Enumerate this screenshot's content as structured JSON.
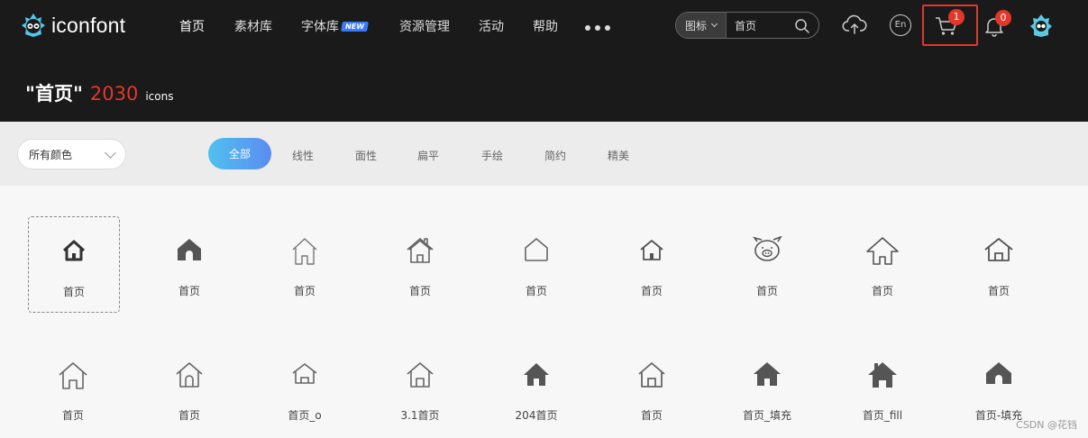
{
  "brand": {
    "name": "iconfont"
  },
  "nav": {
    "items": [
      {
        "label": "首页"
      },
      {
        "label": "素材库"
      },
      {
        "label": "字体库"
      },
      {
        "label": "资源管理"
      },
      {
        "label": "活动"
      },
      {
        "label": "帮助"
      }
    ],
    "new_badge": "NEW"
  },
  "search": {
    "type_label": "图标",
    "value": "首页"
  },
  "header": {
    "lang_label": "En",
    "cart_count": "1",
    "notif_count": "0"
  },
  "title": {
    "query": "\"首页\"",
    "count": "2030",
    "unit": "icons"
  },
  "filters": {
    "color_select": "所有颜色",
    "tabs": [
      {
        "label": "全部",
        "active": true
      },
      {
        "label": "线性"
      },
      {
        "label": "面性"
      },
      {
        "label": "扁平"
      },
      {
        "label": "手绘"
      },
      {
        "label": "简约"
      },
      {
        "label": "精美"
      }
    ]
  },
  "icons": [
    {
      "label": "首页",
      "icon": "home-outline-bold-icon"
    },
    {
      "label": "首页",
      "icon": "home-filled-icon"
    },
    {
      "label": "首页",
      "icon": "home-outline-thin-icon"
    },
    {
      "label": "首页",
      "icon": "home-chimney-icon"
    },
    {
      "label": "首页",
      "icon": "home-rounded-outline-icon"
    },
    {
      "label": "首页",
      "icon": "home-small-outline-icon"
    },
    {
      "label": "首页",
      "icon": "pig-face-icon"
    },
    {
      "label": "首页",
      "icon": "home-arrow-outline-icon"
    },
    {
      "label": "首页",
      "icon": "home-door-outline-icon"
    },
    {
      "label": "首页",
      "icon": "home-line-icon"
    },
    {
      "label": "首页",
      "icon": "home-line-rounded-icon"
    },
    {
      "label": "首页_o",
      "icon": "home-flat-outline-icon"
    },
    {
      "label": "3.1首页",
      "icon": "home-line-alt-icon"
    },
    {
      "label": "204首页",
      "icon": "home-solid-icon"
    },
    {
      "label": "首页",
      "icon": "home-door-outline-alt-icon"
    },
    {
      "label": "首页_填充",
      "icon": "home-solid-wide-icon"
    },
    {
      "label": "首页_fill",
      "icon": "home-chimney-solid-icon"
    },
    {
      "label": "首页-填充",
      "icon": "home-solid-arch-icon"
    }
  ],
  "watermark": "CSDN @花铛"
}
